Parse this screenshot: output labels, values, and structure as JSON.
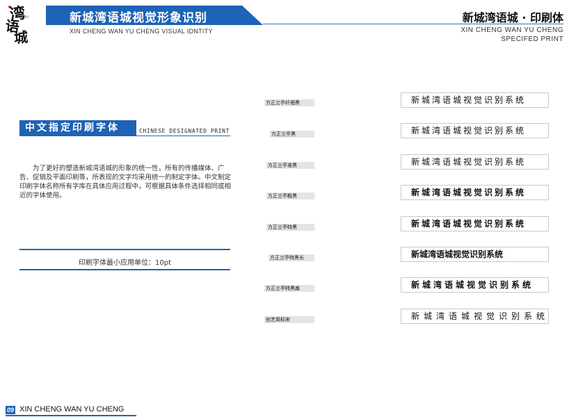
{
  "header": {
    "title": "新城湾语城视觉形象识别",
    "subtitle_en": "XIN CHENG WAN YU CHENG VISUAL IDNTITY",
    "right_title": "新城湾语城 · 印刷体",
    "right_en_line1": "XIN CHENG WAN YU CHENG",
    "right_en_line2": "SPECIFED PRINT",
    "accent_color": "#1e63b5"
  },
  "logo": {
    "chars": [
      "湾",
      "语",
      "城"
    ],
    "tiny_text": "WANYU"
  },
  "section": {
    "heading": "中文指定印刷字体",
    "heading_en": "CHINESE DESIGNATED PRINT",
    "paragraph": "为了更好的塑造新城湾语城的形象的统一性，所有的传播媒体、广告、促销及平面印刷等，所表现的文字均采用统一的制定字体。中文制定印刷字体名称所有字库在具体应用过程中，可根据具体条件选择相同或相近的字体使用。",
    "min_unit": "印刷字体最小应用单位：10pt"
  },
  "font_rows": [
    {
      "label": "方正兰亭纤细黑",
      "sample": "新城湾语城视觉识别系统",
      "weight": "200",
      "spacing": "3px"
    },
    {
      "label": "方正兰亭黑",
      "sample": "新城湾语城视觉识别系统",
      "weight": "400",
      "spacing": "3px"
    },
    {
      "label": "方正兰亭准黑",
      "sample": "新城湾语城视觉识别系统",
      "weight": "500",
      "spacing": "3px"
    },
    {
      "label": "方正兰亭粗黑",
      "sample": "新城湾语城视觉识别系统",
      "weight": "700",
      "spacing": "3px"
    },
    {
      "label": "方正兰亭特黑",
      "sample": "新城湾语城视觉识别系统",
      "weight": "800",
      "spacing": "3px"
    },
    {
      "label": "方正兰亭特黑长",
      "sample": "新城湾语城视觉识别系统",
      "weight": "800",
      "spacing": "0px"
    },
    {
      "label": "方正兰亭特黑扁",
      "sample": "新城湾语城视觉识别系统",
      "weight": "900",
      "spacing": "4px"
    },
    {
      "label": "创艺简标宋",
      "sample": "新城湾语城视觉识别系统",
      "weight": "400",
      "spacing": "6px"
    }
  ],
  "footer": {
    "page_number": "09",
    "text": "XIN CHENG WAN YU CHENG"
  }
}
